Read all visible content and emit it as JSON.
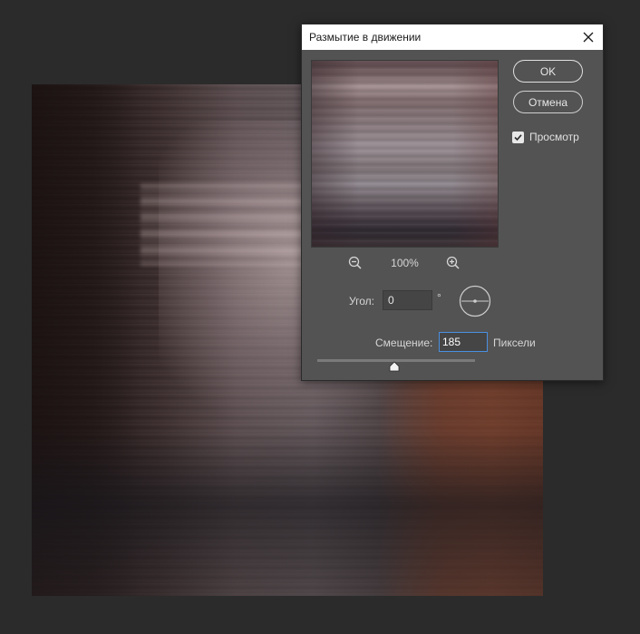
{
  "dialog": {
    "title": "Размытие в движении",
    "ok_label": "OK",
    "cancel_label": "Отмена",
    "preview_checkbox": {
      "label": "Просмотр",
      "checked": true
    },
    "zoom": {
      "value": "100%"
    },
    "angle": {
      "label": "Угол:",
      "value": "0",
      "unit": "°"
    },
    "offset": {
      "label": "Смещение:",
      "value": "185",
      "unit": "Пиксели",
      "slider_fraction": 0.49
    }
  },
  "icons": {
    "close": "close-icon",
    "zoom_out": "zoom-out-icon",
    "zoom_in": "zoom-in-icon",
    "angle_dial": "angle-dial-icon",
    "check": "checkmark-icon",
    "slider_thumb": "slider-thumb-icon"
  },
  "colors": {
    "workspace": "#2b2b2b",
    "dialog_bg": "#535353",
    "title_bg": "#ffffff",
    "focus_accent": "#4a8fe0"
  }
}
